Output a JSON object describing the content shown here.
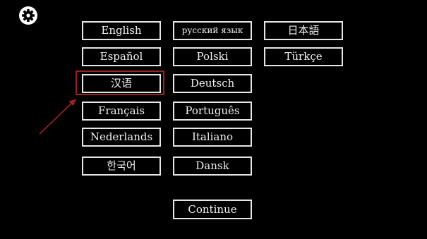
{
  "settings": {
    "icon": "gear-icon"
  },
  "languages": {
    "col1": [
      "English",
      "Español",
      "汉语",
      "Français",
      "Nederlands",
      "한국어"
    ],
    "col2": [
      "русский язык",
      "Polski",
      "Deutsch",
      "Português",
      "Italiano",
      "Dansk"
    ],
    "col3": [
      "日本語",
      "Türkçe"
    ]
  },
  "highlight": {
    "color": "#9b2222",
    "target": "汉语"
  },
  "continue_label": "Continue"
}
